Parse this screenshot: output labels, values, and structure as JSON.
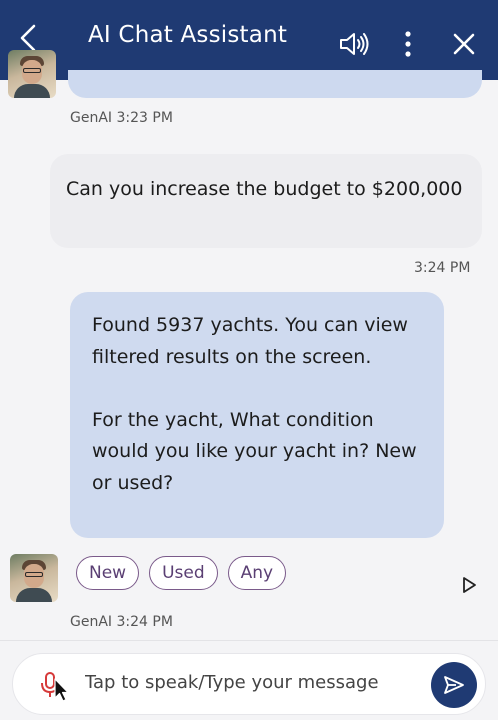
{
  "header": {
    "title": "AI Chat Assistant",
    "background": "#1f3a73",
    "icons": [
      "chevron-left-icon",
      "speaker-icon",
      "more-vertical-icon",
      "close-icon"
    ]
  },
  "messages": {
    "prev_meta": "GenAI 3:23 PM",
    "user_text": "Can you increase the budget to $200,000",
    "user_time": "3:24 PM",
    "bot_text": "Found 5937 yachts. You can view filtered results on the screen.\n\nFor the yacht, What condition would you like your yacht in? New or used?",
    "bot_meta": "GenAI 3:24 PM"
  },
  "chips": [
    "New",
    "Used",
    "Any"
  ],
  "input": {
    "placeholder": "Tap to speak/Type your message",
    "value": ""
  },
  "colors": {
    "bot_bubble": "#cfdaef",
    "user_bubble": "#ededf0",
    "chip_border": "#7a5a8a",
    "mic": "#d63a3a"
  }
}
